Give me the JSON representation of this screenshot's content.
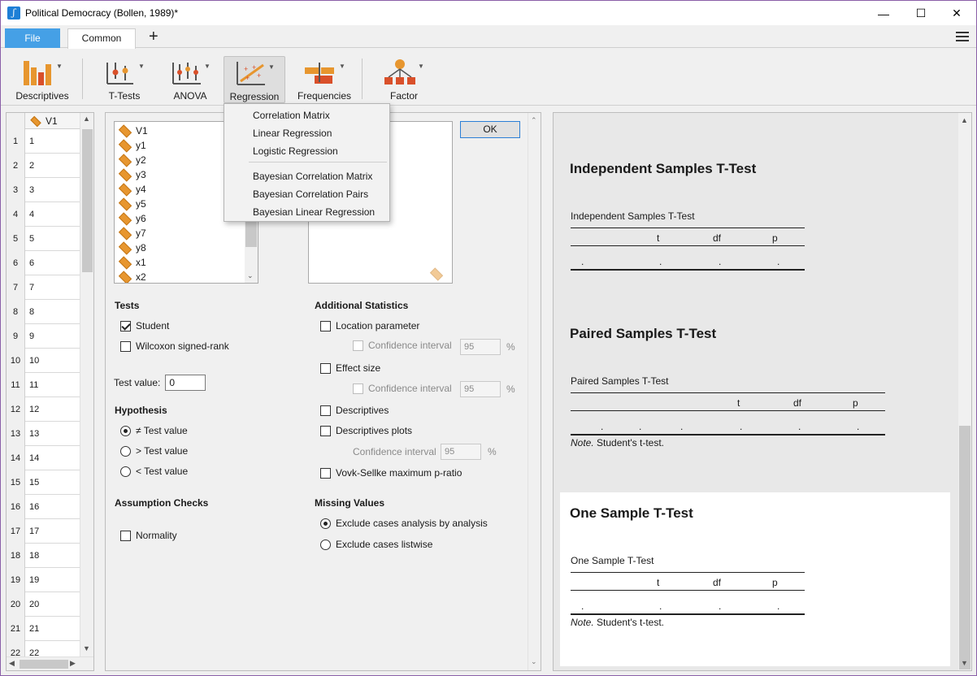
{
  "window": {
    "title": "Political Democracy (Bollen, 1989)*",
    "minimize": "—",
    "maximize": "☐",
    "close": "✕"
  },
  "tabs": {
    "file": "File",
    "common": "Common",
    "add": "+"
  },
  "ribbon": {
    "descriptives": "Descriptives",
    "ttests": "T-Tests",
    "anova": "ANOVA",
    "regression": "Regression",
    "frequencies": "Frequencies",
    "factor": "Factor"
  },
  "accent_colors": {
    "file_tab": "#45a0e6",
    "icon_orange": "#e7962f",
    "icon_red": "#d9502a",
    "title_border": "#8a5fa8"
  },
  "data_table": {
    "column": "V1",
    "rows": [
      "1",
      "2",
      "3",
      "4",
      "5",
      "6",
      "7",
      "8",
      "9",
      "10",
      "11",
      "12",
      "13",
      "14",
      "15",
      "16",
      "17",
      "18",
      "19",
      "20",
      "21",
      "22"
    ],
    "values": [
      "1",
      "2",
      "3",
      "4",
      "5",
      "6",
      "7",
      "8",
      "9",
      "10",
      "11",
      "12",
      "13",
      "14",
      "15",
      "16",
      "17",
      "18",
      "19",
      "20",
      "21",
      "22"
    ]
  },
  "variables": [
    "V1",
    "y1",
    "y2",
    "y3",
    "y4",
    "y5",
    "y6",
    "y7",
    "y8",
    "x1",
    "x2"
  ],
  "ok_label": "OK",
  "tests": {
    "heading": "Tests",
    "student": "Student",
    "wilcoxon": "Wilcoxon signed-rank"
  },
  "test_value": {
    "label": "Test value:",
    "value": "0"
  },
  "hypothesis": {
    "heading": "Hypothesis",
    "ne": "≠ Test value",
    "gt": "> Test value",
    "lt": "< Test value"
  },
  "assumption": {
    "heading": "Assumption Checks",
    "normality": "Normality"
  },
  "additional": {
    "heading": "Additional Statistics",
    "location": "Location parameter",
    "ci": "Confidence interval",
    "ci_value": "95",
    "pct": "%",
    "effect": "Effect size",
    "descriptives": "Descriptives",
    "desc_plots": "Descriptives plots",
    "vovk": "Vovk-Sellke maximum p-ratio"
  },
  "missing": {
    "heading": "Missing Values",
    "analysis": "Exclude cases analysis by analysis",
    "listwise": "Exclude cases listwise"
  },
  "results": {
    "independent": {
      "heading": "Independent Samples T-Test",
      "table_title": "Independent Samples T-Test"
    },
    "paired": {
      "heading": "Paired Samples T-Test",
      "table_title": "Paired Samples T-Test"
    },
    "one_sample": {
      "heading": "One Sample T-Test",
      "table_title": "One Sample T-Test"
    },
    "cols": {
      "t": "t",
      "df": "df",
      "p": "p"
    },
    "dot": ".",
    "note_label": "Note.",
    "note_text": " Student's t-test."
  },
  "regression_menu": [
    "Correlation Matrix",
    "Linear Regression",
    "Logistic Regression",
    "Bayesian Correlation Matrix",
    "Bayesian Correlation Pairs",
    "Bayesian Linear Regression"
  ]
}
